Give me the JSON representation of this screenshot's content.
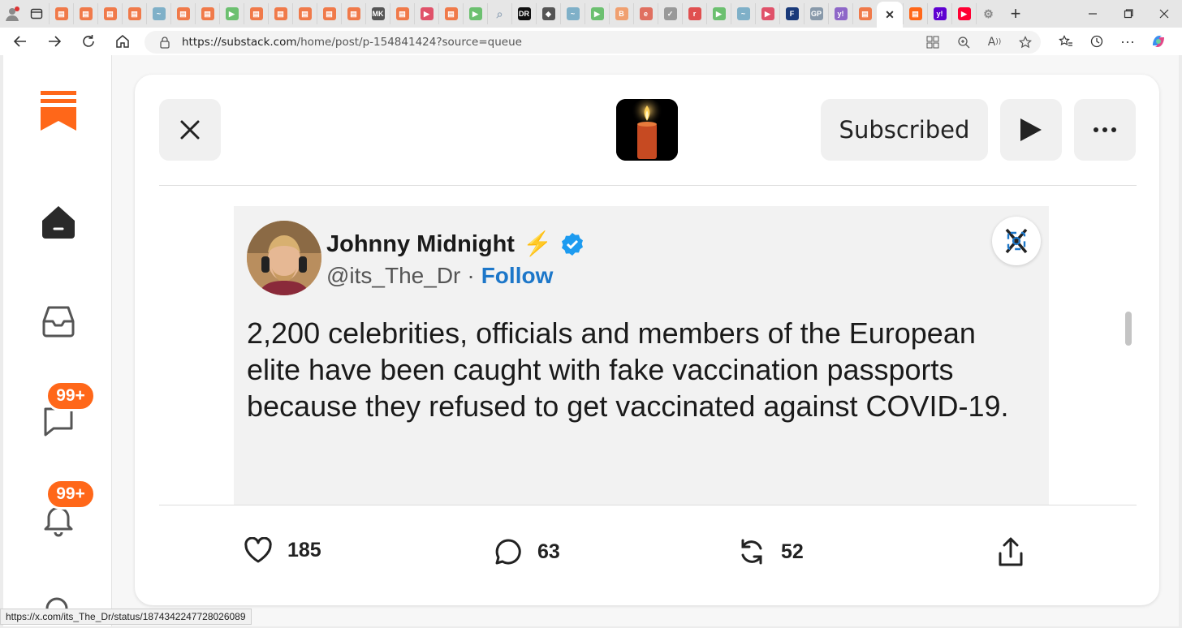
{
  "browser": {
    "tabs": [
      {
        "icon": "substack-icon",
        "color": "#f07a4a"
      },
      {
        "icon": "substack-icon",
        "color": "#f07a4a"
      },
      {
        "icon": "substack-icon",
        "color": "#f07a4a"
      },
      {
        "icon": "substack-icon",
        "color": "#f07a4a"
      },
      {
        "icon": "pulse-icon",
        "color": "#7fb0c8"
      },
      {
        "icon": "substack-icon",
        "color": "#f07a4a"
      },
      {
        "icon": "substack-icon",
        "color": "#f07a4a"
      },
      {
        "icon": "play-icon",
        "color": "#6cc070"
      },
      {
        "icon": "substack-icon",
        "color": "#f07a4a"
      },
      {
        "icon": "substack-icon",
        "color": "#f07a4a"
      },
      {
        "icon": "substack-icon",
        "color": "#f07a4a"
      },
      {
        "icon": "substack-icon",
        "color": "#f07a4a"
      },
      {
        "icon": "substack-icon",
        "color": "#f07a4a"
      },
      {
        "icon": "mk-icon",
        "color": "#555555"
      },
      {
        "icon": "substack-icon",
        "color": "#f07a4a"
      },
      {
        "icon": "youtube-icon",
        "color": "#e0526a"
      },
      {
        "icon": "substack-icon",
        "color": "#f07a4a"
      },
      {
        "icon": "play-icon",
        "color": "#6cc070"
      },
      {
        "icon": "search-icon",
        "color": "#9ab"
      },
      {
        "icon": "dr-icon",
        "color": "#111111"
      },
      {
        "icon": "diamond-icon",
        "color": "#555555"
      },
      {
        "icon": "pulse-icon",
        "color": "#7fb0c8"
      },
      {
        "icon": "play-icon",
        "color": "#6cc070"
      },
      {
        "icon": "b-icon",
        "color": "#f0a070"
      },
      {
        "icon": "e-icon",
        "color": "#e07060"
      },
      {
        "icon": "bird-icon",
        "color": "#999999"
      },
      {
        "icon": "r-icon",
        "color": "#e05050"
      },
      {
        "icon": "play-icon",
        "color": "#6cc070"
      },
      {
        "icon": "pulse-icon",
        "color": "#7fb0c8"
      },
      {
        "icon": "youtube-icon",
        "color": "#e0526a"
      },
      {
        "icon": "foxnews-icon",
        "color": "#1a3a7a"
      },
      {
        "icon": "gp-icon",
        "color": "#8899aa"
      },
      {
        "icon": "yahoo-icon",
        "color": "#8e67c8"
      },
      {
        "icon": "substack-icon",
        "color": "#f07a4a"
      },
      {
        "icon": "close-icon",
        "color": "#333333",
        "active": true
      },
      {
        "icon": "substack-icon",
        "color": "#ff6719"
      },
      {
        "icon": "yahoo-icon",
        "color": "#5f01d1"
      },
      {
        "icon": "youtube-icon",
        "color": "#ff0033"
      },
      {
        "icon": "gear-icon",
        "color": "#888888"
      }
    ],
    "url_host": "https://substack.com",
    "url_path": "/home/post/p-154841424?source=queue",
    "status_url": "https://x.com/its_The_Dr/status/1874342247728026089"
  },
  "sidebar": {
    "chat_badge": "99+",
    "activity_badge": "99+"
  },
  "post": {
    "subscribe_label": "Subscribed",
    "tweet": {
      "name": "Johnny Midnight",
      "name_emoji": "⚡",
      "handle": "@its_The_Dr",
      "separator": "·",
      "follow_label": "Follow",
      "text": "2,200 celebrities, officials and members of the European elite have been caught with fake vaccination passports because they refused to get vaccinated against COVID-19."
    },
    "actions": {
      "likes": "185",
      "comments": "63",
      "restacks": "52"
    }
  },
  "colors": {
    "accent": "#ff6719",
    "link": "#1d77c9",
    "verified": "#1d9bf0"
  }
}
